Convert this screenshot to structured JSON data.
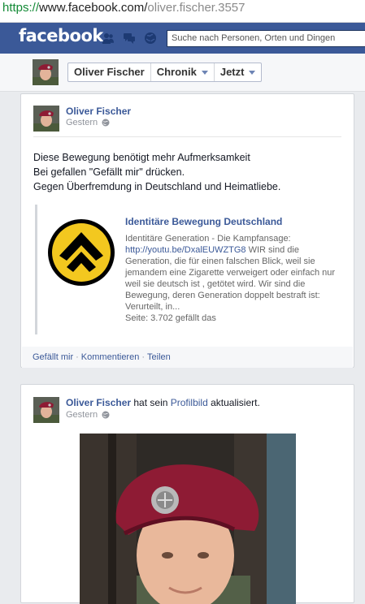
{
  "browser": {
    "url_scheme": "https://",
    "url_host": "www.facebook.com/",
    "url_path": "oliver.fischer.3557"
  },
  "topbar": {
    "logo": "facebook",
    "search_placeholder": "Suche nach Personen, Orten und Dingen"
  },
  "profile_header": {
    "crumbs": [
      {
        "label": "Oliver Fischer"
      },
      {
        "label": "Chronik"
      },
      {
        "label": "Jetzt"
      }
    ]
  },
  "post1": {
    "author": "Oliver Fischer",
    "time": "Gestern",
    "lines": [
      "Diese Bewegung benötigt mehr Aufmerksamkeit",
      "Bei gefallen \"Gefällt mir\" drücken.",
      "Gegen Überfremdung in Deutschland und Heimatliebe."
    ],
    "share": {
      "title": "Identitäre Bewegung Deutschland",
      "desc_lead": "Identitäre Generation - Die Kampfansage: ",
      "desc_link": "http://youtu.be/DxalEUWZTG8",
      "desc_rest": " WIR sind die Generation, die für einen falschen Blick, weil sie jemandem eine Zigarette verweigert oder einfach nur weil sie deutsch ist , getötet wird. Wir sind die Bewegung, deren Generation doppelt bestraft ist: Verurteilt, in...",
      "likes": "Seite: 3.702 gefällt das"
    },
    "actions": {
      "like": "Gefällt mir",
      "comment": "Kommentieren",
      "share": "Teilen"
    }
  },
  "post2": {
    "author": "Oliver Fischer",
    "action_pre": " hat sein ",
    "action_link": "Profilbild",
    "action_post": " aktualisiert.",
    "time": "Gestern"
  },
  "colors": {
    "fb_blue": "#3b5998",
    "logo_yellow": "#f3c81f",
    "beret": "#8e1b34"
  }
}
